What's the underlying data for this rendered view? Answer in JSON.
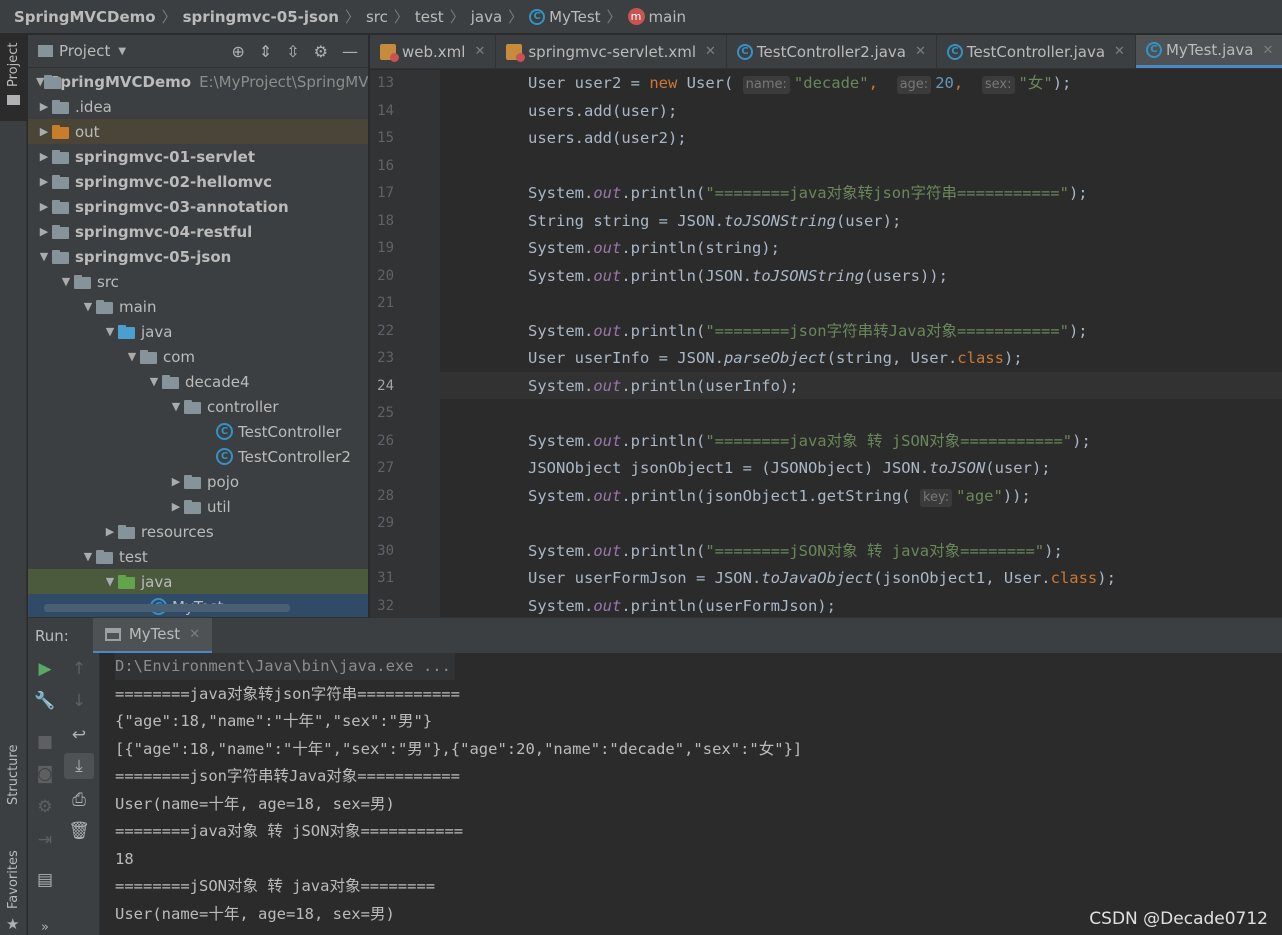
{
  "breadcrumb": {
    "project": "SpringMVCDemo",
    "module": "springmvc-05-json",
    "dir1": "src",
    "dir2": "test",
    "dir3": "java",
    "class_name": "MyTest",
    "method": "main"
  },
  "left_stripe": {
    "project_tab": "Project",
    "structure_tab": "Structure",
    "favorites_tab": "Favorites"
  },
  "project_panel": {
    "title": "Project",
    "dropdown_icon": "chevron-down-icon",
    "tools": [
      "target-icon",
      "expand-all-icon",
      "collapse-all-icon",
      "gear-icon",
      "minimize-icon"
    ],
    "tree": [
      {
        "label": "SpringMVCDemo",
        "path": "E:\\MyProject\\SpringMV",
        "bold": true
      },
      {
        "label": ".idea"
      },
      {
        "label": "out"
      },
      {
        "label": "springmvc-01-servlet",
        "bold": true
      },
      {
        "label": "springmvc-02-hellomvc",
        "bold": true
      },
      {
        "label": "springmvc-03-annotation",
        "bold": true
      },
      {
        "label": "springmvc-04-restful",
        "bold": true
      },
      {
        "label": "springmvc-05-json",
        "bold": true
      },
      {
        "label": "src"
      },
      {
        "label": "main"
      },
      {
        "label": "java"
      },
      {
        "label": "com"
      },
      {
        "label": "decade4"
      },
      {
        "label": "controller"
      },
      {
        "label": "TestController"
      },
      {
        "label": "TestController2"
      },
      {
        "label": "pojo"
      },
      {
        "label": "util"
      },
      {
        "label": "resources"
      },
      {
        "label": "test"
      },
      {
        "label": "java"
      },
      {
        "label": "MyTest"
      }
    ]
  },
  "editor": {
    "tabs": [
      {
        "label": "web.xml"
      },
      {
        "label": "springmvc-servlet.xml"
      },
      {
        "label": "TestController2.java"
      },
      {
        "label": "TestController.java"
      },
      {
        "label": "MyTest.java"
      }
    ],
    "line_numbers": [
      "13",
      "14",
      "15",
      "16",
      "17",
      "18",
      "19",
      "20",
      "21",
      "22",
      "23",
      "24",
      "25",
      "26",
      "27",
      "28",
      "29",
      "30",
      "31",
      "32"
    ],
    "current_line": "24",
    "hints": {
      "name": "name:",
      "age": "age:",
      "sex": "sex:",
      "key": "key:"
    },
    "code": {
      "l13_a": "User user2 = ",
      "l13_new": "new",
      "l13_b": " User(",
      "l13_s1": "\"decade\"",
      "l13_n": "20",
      "l13_s2": "\"女\"",
      "l13_end": ");",
      "l14": "users.add(user);",
      "l15": "users.add(user2);",
      "sys": "System.",
      "out": "out",
      "println_open": ".println(",
      "s17": "\"========java对象转json字符串===========\"",
      "l18_a": "String string = JSON.",
      "l18_m": "toJSONString",
      "l18_b": "(user);",
      "l19_b": "(string);",
      "l20_b": "(JSON.",
      "l20_m": "toJSONString",
      "l20_c": "(users));",
      "s22": "\"========json字符串转Java对象===========\"",
      "l23_a": "User userInfo = JSON.",
      "l23_m": "parseObject",
      "l23_b": "(string, User.",
      "class_kw": "class",
      "l24_b": "(userInfo);",
      "s26": "\"========java对象 转 jSON对象===========\"",
      "l27_a": "JSONObject jsonObject1 = (JSONObject) JSON.",
      "l27_m": "toJSON",
      "l27_b": "(user);",
      "l28_b": "(jsonObject1.getString(",
      "l28_s": "\"age\"",
      "l28_c": "));",
      "s30": "\"========jSON对象 转 java对象========\"",
      "l31_a": "User userFormJson = JSON.",
      "l31_m": "toJavaObject",
      "l31_b": "(jsonObject1, User.",
      "l32_b": "(userFormJson);",
      "end": ");",
      "end_semi": ";"
    }
  },
  "run_panel": {
    "label": "Run:",
    "tab": "MyTest",
    "output": [
      "D:\\Environment\\Java\\bin\\java.exe ...",
      "========java对象转json字符串===========",
      "{\"age\":18,\"name\":\"十年\",\"sex\":\"男\"}",
      "[{\"age\":18,\"name\":\"十年\",\"sex\":\"男\"},{\"age\":20,\"name\":\"decade\",\"sex\":\"女\"}]",
      "========json字符串转Java对象===========",
      "User(name=十年, age=18, sex=男)",
      "========java对象 转 jSON对象===========",
      "18",
      "========jSON对象 转 java对象========",
      "User(name=十年, age=18, sex=男)"
    ]
  },
  "watermark": "CSDN @Decade0712"
}
